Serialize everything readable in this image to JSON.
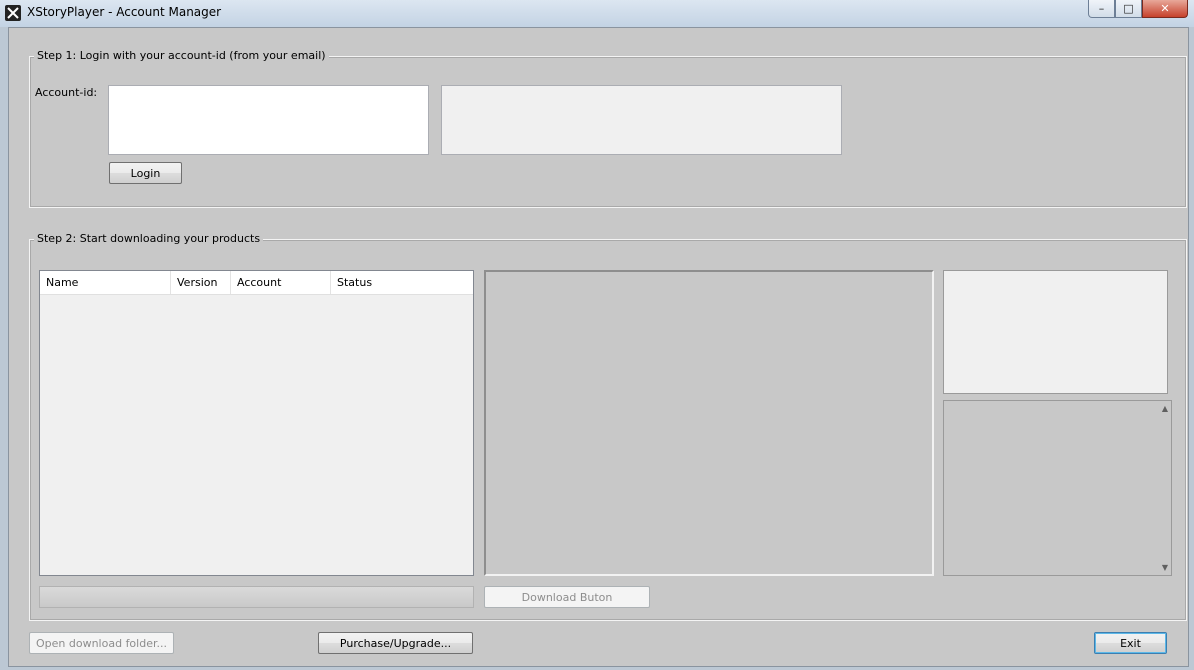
{
  "window": {
    "title": "XStoryPlayer - Account Manager",
    "min_glyph": "–",
    "max_glyph": "□",
    "close_glyph": "✕"
  },
  "step1": {
    "legend": "Step 1:  Login with your account-id (from your email)",
    "account_label": "Account-id:",
    "account_value": "",
    "login_label": "Login"
  },
  "step2": {
    "legend": "Step 2:  Start downloading your products",
    "columns": [
      "Name",
      "Version",
      "Account",
      "Status"
    ],
    "download_label": "Download Buton",
    "progress": 0,
    "scroll_up": "▲",
    "scroll_down": "▼"
  },
  "footer": {
    "open_folder_label": "Open download folder...",
    "purchase_label": "Purchase/Upgrade...",
    "exit_label": "Exit"
  }
}
